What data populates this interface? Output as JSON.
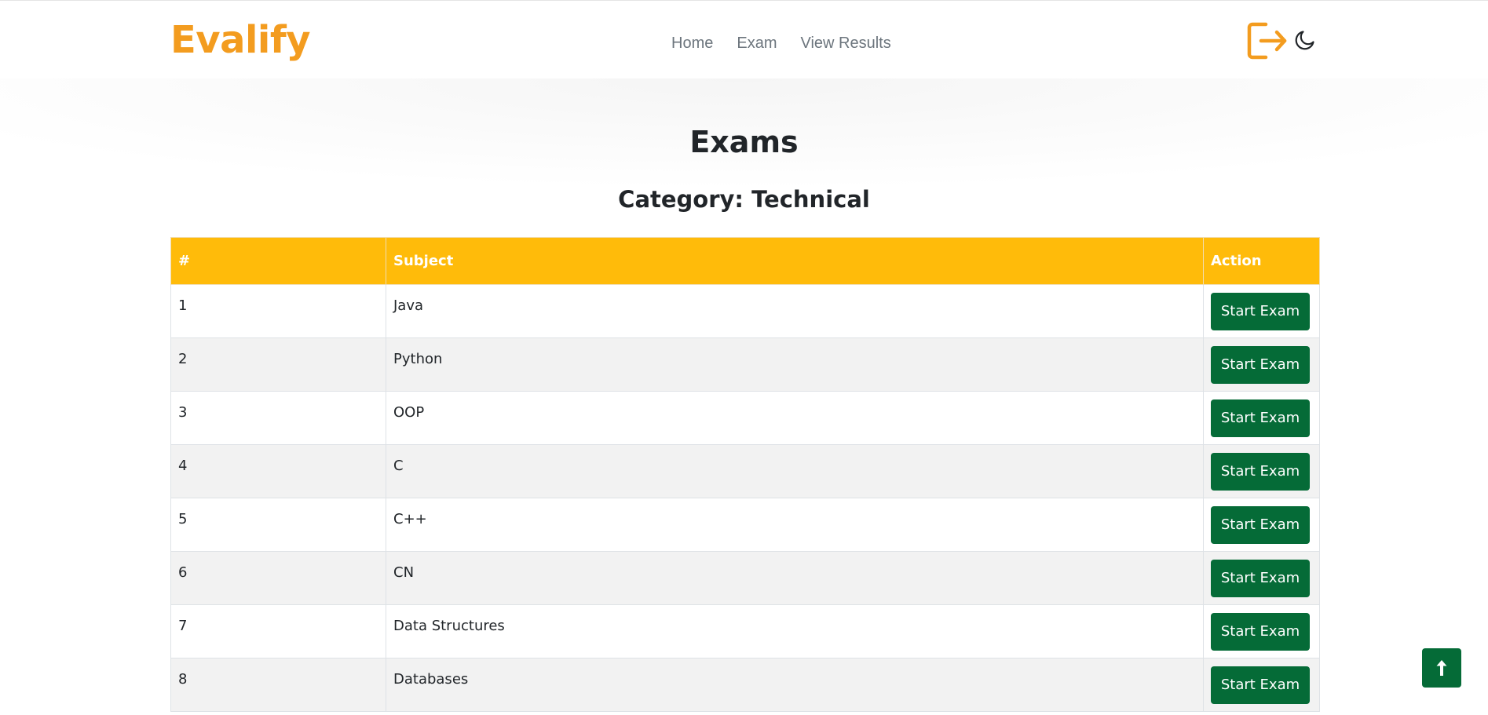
{
  "brand": {
    "name": "Evalify",
    "color": "#f39c1f"
  },
  "nav": {
    "links": [
      "Home",
      "Exam",
      "View Results"
    ]
  },
  "header_icons": {
    "logout": "logout-icon",
    "theme": "moon-icon"
  },
  "page": {
    "title": "Exams",
    "category": "Category: Technical"
  },
  "table": {
    "headers": [
      "#",
      "Subject",
      "Action"
    ],
    "header_color": "#ffbb0a",
    "rows": [
      {
        "num": "1",
        "subject": "Java",
        "action": "Start Exam"
      },
      {
        "num": "2",
        "subject": "Python",
        "action": "Start Exam"
      },
      {
        "num": "3",
        "subject": "OOP",
        "action": "Start Exam"
      },
      {
        "num": "4",
        "subject": "C",
        "action": "Start Exam"
      },
      {
        "num": "5",
        "subject": "C++",
        "action": "Start Exam"
      },
      {
        "num": "6",
        "subject": "CN",
        "action": "Start Exam"
      },
      {
        "num": "7",
        "subject": "Data Structures",
        "action": "Start Exam"
      },
      {
        "num": "8",
        "subject": "Databases",
        "action": "Start Exam"
      }
    ]
  },
  "button_color": "#056b37",
  "back_to_top": {
    "icon": "arrow-up-icon"
  }
}
